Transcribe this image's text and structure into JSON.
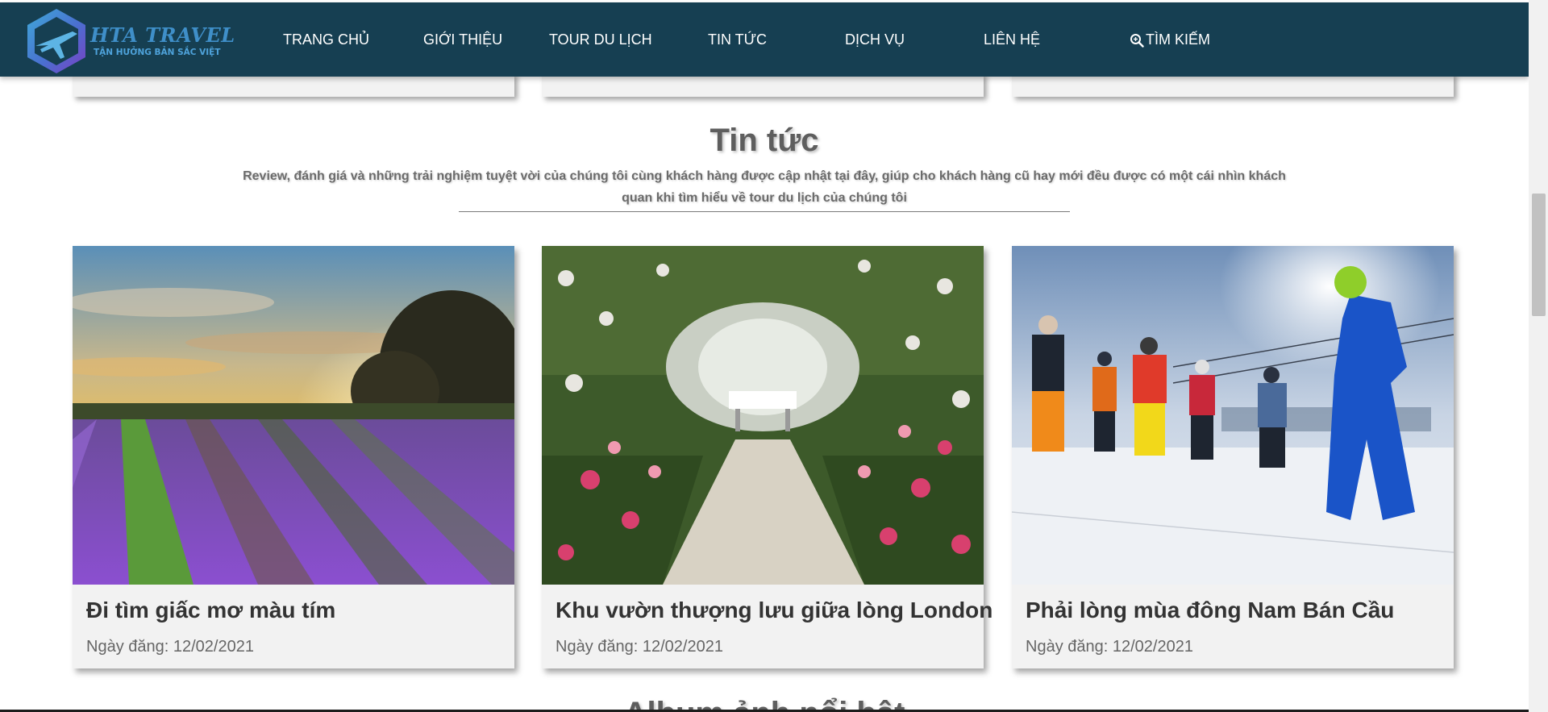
{
  "header": {
    "logo": {
      "title": "HTA TRAVEL",
      "slogan": "TẬN HƯỞNG BẢN SẮC VIỆT"
    },
    "nav": [
      {
        "label": "TRANG CHỦ"
      },
      {
        "label": "GIỚI THIỆU"
      },
      {
        "label": "TOUR DU LỊCH"
      },
      {
        "label": "TIN TỨC"
      },
      {
        "label": "DỊCH VỤ"
      },
      {
        "label": "LIÊN HỆ"
      },
      {
        "label": "TÌM KIẾM",
        "icon": "search-icon"
      }
    ]
  },
  "news": {
    "title": "Tin tức",
    "description": "Review, đánh giá và những trải nghiệm tuyệt vời của chúng tôi cùng khách hàng được cập nhật tại đây, giúp cho khách hàng cũ hay mới đều được có một cái nhìn khách quan khi tìm hiểu về tour du lịch của chúng tôi",
    "cards": [
      {
        "title": "Đi tìm giấc mơ màu tím",
        "date": "Ngày đăng: 12/02/2021",
        "image": "lavender-field-sunset"
      },
      {
        "title": "Khu vườn thượng lưu giữa lòng London",
        "date": "Ngày đăng: 12/02/2021",
        "image": "rose-garden-arch"
      },
      {
        "title": "Phải lòng mùa đông Nam Bán Cầu",
        "date": "Ngày đăng: 12/02/2021",
        "image": "ski-group-snow"
      }
    ]
  },
  "next_section": {
    "title": "Album ảnh nổi bật"
  },
  "colors": {
    "header_bg": "#163f52",
    "card_bg": "#f2f2f2",
    "heading": "#5e5e5e"
  }
}
